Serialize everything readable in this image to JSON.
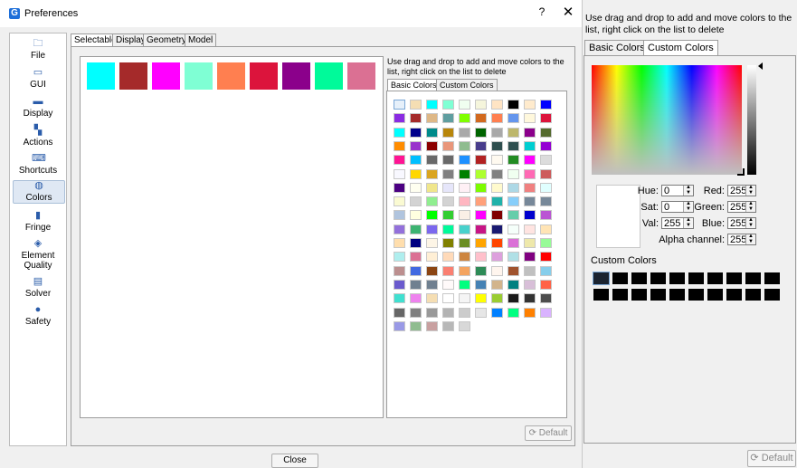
{
  "window": {
    "title": "Preferences",
    "help": "?",
    "close": "✕",
    "app_icon": "G"
  },
  "sidebar": [
    {
      "label": "File",
      "icon": "folder-icon",
      "active": false
    },
    {
      "label": "GUI",
      "icon": "window-icon",
      "active": false
    },
    {
      "label": "Display",
      "icon": "display-icon",
      "active": false
    },
    {
      "label": "Actions",
      "icon": "actions-icon",
      "active": false
    },
    {
      "label": "Shortcuts",
      "icon": "keyboard-icon",
      "active": false
    },
    {
      "label": "Colors",
      "icon": "palette-icon",
      "active": true
    },
    {
      "label": "Fringe",
      "icon": "fringe-icon",
      "active": false
    },
    {
      "label": "Element Quality",
      "icon": "element-quality-icon",
      "active": false
    },
    {
      "label": "Solver",
      "icon": "solver-icon",
      "active": false
    },
    {
      "label": "Safety",
      "icon": "safety-icon",
      "active": false
    }
  ],
  "tabs": [
    "Selectable",
    "Display",
    "Geometry",
    "Model"
  ],
  "selected_colors": [
    "#00ffff",
    "#a52a2a",
    "#ff00ff",
    "#7fffd4",
    "#ff7f50",
    "#dc143c",
    "#8b008b",
    "#00fa9a",
    "#db7093"
  ],
  "palette": {
    "hint": "Use drag and drop to add and move colors to the list, right click on the list to delete",
    "tabs": [
      "Basic Colors",
      "Custom Colors"
    ],
    "colors": [
      "#e6f0fa",
      "#f5deb3",
      "#00ffff",
      "#7fffd4",
      "#f0fff0",
      "#f5f5dc",
      "#ffe4c4",
      "#000000",
      "#ffebcd",
      "#0000ff",
      "#8a2be2",
      "#a52a2a",
      "#deb887",
      "#5f9ea0",
      "#7fff00",
      "#d2691e",
      "#ff7f50",
      "#6495ed",
      "#fff8dc",
      "#dc143c",
      "#00ffff",
      "#00008b",
      "#008b8b",
      "#b8860b",
      "#a9a9a9",
      "#006400",
      "#a9a9a9",
      "#bdb76b",
      "#8b008b",
      "#556b2f",
      "#ff8c00",
      "#9932cc",
      "#8b0000",
      "#e9967a",
      "#8fbc8f",
      "#483d8b",
      "#2f4f4f",
      "#2f4f4f",
      "#00ced1",
      "#9400d3",
      "#ff1493",
      "#00bfff",
      "#696969",
      "#696969",
      "#1e90ff",
      "#b22222",
      "#fffaf0",
      "#228b22",
      "#ff00ff",
      "#dcdcdc",
      "#f8f8ff",
      "#ffd700",
      "#daa520",
      "#808080",
      "#008000",
      "#adff2f",
      "#808080",
      "#f0fff0",
      "#ff69b4",
      "#cd5c5c",
      "#4b0082",
      "#fffff0",
      "#f0e68c",
      "#e6e6fa",
      "#fff0f5",
      "#7cfc00",
      "#fffacd",
      "#add8e6",
      "#f08080",
      "#e0ffff",
      "#fafad2",
      "#d3d3d3",
      "#90ee90",
      "#d3d3d3",
      "#ffb6c1",
      "#ffa07a",
      "#20b2aa",
      "#87cefa",
      "#778899",
      "#778899",
      "#b0c4de",
      "#ffffe0",
      "#00ff00",
      "#32cd32",
      "#faf0e6",
      "#ff00ff",
      "#800000",
      "#66cdaa",
      "#0000cd",
      "#ba55d3",
      "#9370db",
      "#3cb371",
      "#7b68ee",
      "#00fa9a",
      "#48d1cc",
      "#c71585",
      "#191970",
      "#f5fffa",
      "#ffe4e1",
      "#ffe4b5",
      "#ffdead",
      "#000080",
      "#fdf5e6",
      "#808000",
      "#6b8e23",
      "#ffa500",
      "#ff4500",
      "#da70d6",
      "#eee8aa",
      "#98fb98",
      "#afeeee",
      "#db7093",
      "#ffefd5",
      "#ffdab9",
      "#cd853f",
      "#ffc0cb",
      "#dda0dd",
      "#b0e0e6",
      "#800080",
      "#ff0000",
      "#bc8f8f",
      "#4169e1",
      "#8b4513",
      "#fa8072",
      "#f4a460",
      "#2e8b57",
      "#fff5ee",
      "#a0522d",
      "#c0c0c0",
      "#87ceeb",
      "#6a5acd",
      "#708090",
      "#708090",
      "#fffafa",
      "#00ff7f",
      "#4682b4",
      "#d2b48c",
      "#008080",
      "#d8bfd8",
      "#ff6347",
      "#40e0d0",
      "#ee82ee",
      "#f5deb3",
      "#ffffff",
      "#f5f5f5",
      "#ffff00",
      "#9acd32",
      "#1a1a1a",
      "#333333",
      "#4d4d4d",
      "#666666",
      "#808080",
      "#999999",
      "#b3b3b3",
      "#cccccc",
      "#e6e6e6",
      "#0080ff",
      "#00ff80",
      "#ff8000",
      "#d9b3ff",
      "#9999e6",
      "#8fbc8f",
      "#c8a0a0",
      "#b8b8b8",
      "#d8d8d8"
    ],
    "default_label": "Default"
  },
  "close_button": "Close",
  "picker": {
    "hint": "Use drag and drop to add and move colors to the list, right click on the list to delete",
    "tabs": [
      "Basic Colors",
      "Custom Colors"
    ],
    "labels": {
      "hue": "Hue:",
      "sat": "Sat:",
      "val": "Val:",
      "red": "Red:",
      "green": "Green:",
      "blue": "Blue:",
      "alpha": "Alpha channel:"
    },
    "values": {
      "hue": "0",
      "sat": "0",
      "val": "255",
      "red": "255",
      "green": "255",
      "blue": "255",
      "alpha": "255"
    },
    "custom_colors_label": "Custom Colors",
    "custom_colors": [
      "#1a2330",
      "#000000",
      "#000000",
      "#000000",
      "#000000",
      "#000000",
      "#000000",
      "#000000",
      "#000000",
      "#000000",
      "#000000",
      "#000000",
      "#000000",
      "#000000",
      "#000000",
      "#000000",
      "#000000",
      "#000000",
      "#000000",
      "#000000"
    ],
    "default_label": "Default"
  }
}
